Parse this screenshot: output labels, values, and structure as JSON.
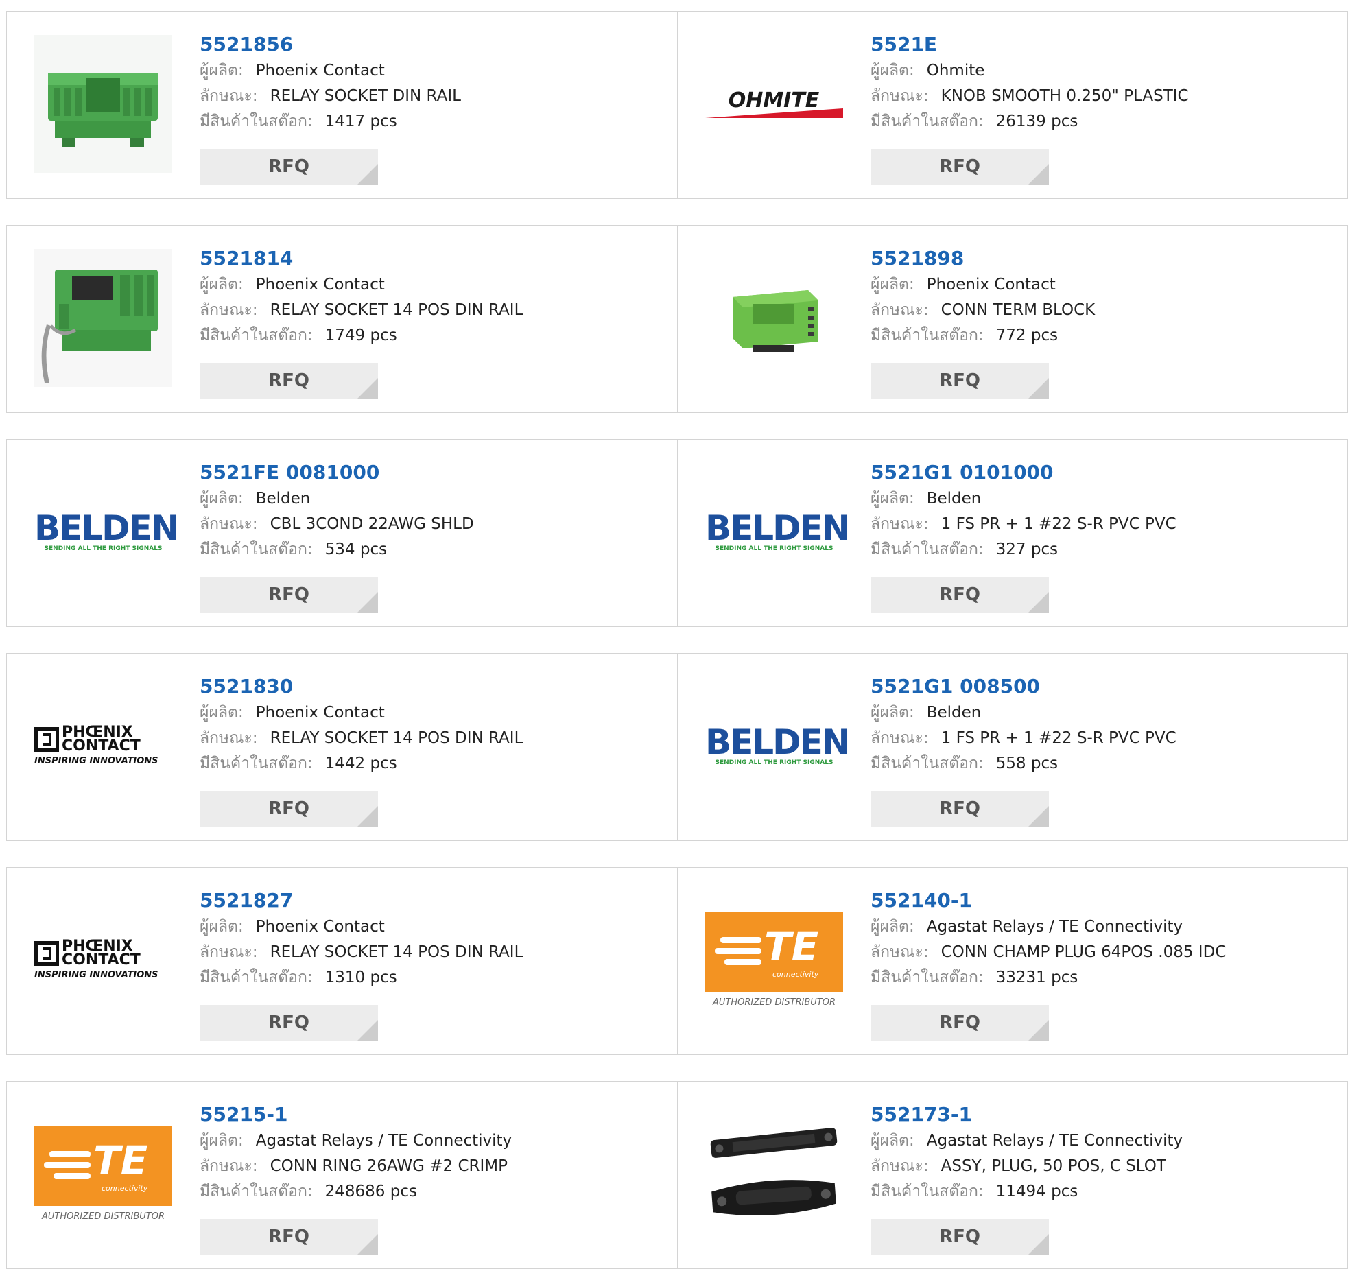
{
  "labels": {
    "manufacturer": "ผู้ผลิต:",
    "description": "ลักษณะ:",
    "stock": "มีสินค้าในสต๊อก:",
    "rfq": "RFQ"
  },
  "logos": {
    "ohmite": "OHMITE",
    "belden": "BELDEN",
    "belden_tagline": "SENDING ALL THE RIGHT SIGNALS",
    "phoenix_line1": "PHŒNIX",
    "phoenix_line2": "CONTACT",
    "phoenix_tagline": "INSPIRING INNOVATIONS",
    "te": "TE",
    "te_sub": "connectivity",
    "te_tagline": "AUTHORIZED DISTRIBUTOR"
  },
  "colors": {
    "link": "#1b64b3",
    "ohmite_red": "#d7182a",
    "belden_blue": "#1d4f9c",
    "belden_green": "#2e9a3e",
    "te_orange": "#f39322",
    "component_green": "#4aa64f"
  },
  "products": [
    {
      "part": "5521856",
      "manufacturer": "Phoenix Contact",
      "description": "RELAY SOCKET DIN RAIL",
      "stock": "1417 pcs",
      "image": "relay-socket-product"
    },
    {
      "part": "5521E",
      "manufacturer": "Ohmite",
      "description": "KNOB SMOOTH 0.250\" PLASTIC",
      "stock": "26139 pcs",
      "image": "ohmite-logo"
    },
    {
      "part": "5521814",
      "manufacturer": "Phoenix Contact",
      "description": "RELAY SOCKET 14 POS DIN RAIL",
      "stock": "1749 pcs",
      "image": "relay-socket-14pos-product"
    },
    {
      "part": "5521898",
      "manufacturer": "Phoenix Contact",
      "description": "CONN TERM BLOCK",
      "stock": "772 pcs",
      "image": "terminal-block-product"
    },
    {
      "part": "5521FE 0081000",
      "manufacturer": "Belden",
      "description": "CBL 3COND 22AWG SHLD",
      "stock": "534 pcs",
      "image": "belden-logo"
    },
    {
      "part": "5521G1 0101000",
      "manufacturer": "Belden",
      "description": "1 FS PR + 1 #22 S-R PVC PVC",
      "stock": "327 pcs",
      "image": "belden-logo"
    },
    {
      "part": "5521830",
      "manufacturer": "Phoenix Contact",
      "description": "RELAY SOCKET 14 POS DIN RAIL",
      "stock": "1442 pcs",
      "image": "phoenix-contact-logo"
    },
    {
      "part": "5521G1 008500",
      "manufacturer": "Belden",
      "description": "1 FS PR + 1 #22 S-R PVC PVC",
      "stock": "558 pcs",
      "image": "belden-logo"
    },
    {
      "part": "5521827",
      "manufacturer": "Phoenix Contact",
      "description": "RELAY SOCKET 14 POS DIN RAIL",
      "stock": "1310 pcs",
      "image": "phoenix-contact-logo"
    },
    {
      "part": "552140-1",
      "manufacturer": "Agastat Relays / TE Connectivity",
      "description": "CONN CHAMP PLUG 64POS .085 IDC",
      "stock": "33231 pcs",
      "image": "te-connectivity-logo"
    },
    {
      "part": "55215-1",
      "manufacturer": "Agastat Relays / TE Connectivity",
      "description": "CONN RING 26AWG #2 CRIMP",
      "stock": "248686 pcs",
      "image": "te-connectivity-logo"
    },
    {
      "part": "552173-1",
      "manufacturer": "Agastat Relays / TE Connectivity",
      "description": "ASSY, PLUG, 50 POS, C SLOT",
      "stock": "11494 pcs",
      "image": "champ-connector-product"
    }
  ]
}
